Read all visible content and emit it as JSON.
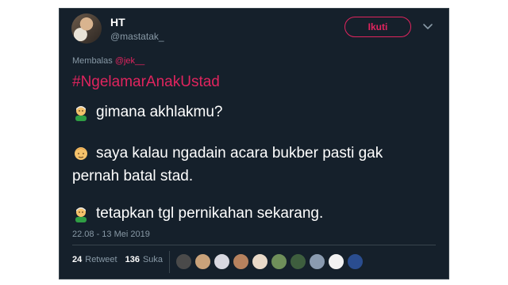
{
  "user": {
    "display_name": "HT",
    "handle": "@mastatak_"
  },
  "follow_button_label": "Ikuti",
  "reply": {
    "prefix": "Membalas",
    "mention": "@jek__"
  },
  "tweet": {
    "hashtag": "#NgelamarAnakUstad",
    "lines": [
      "gimana akhlakmu?",
      "saya kalau ngadain acara bukber pasti gak",
      "pernah batal stad.",
      "tetapkan tgl pernikahan sekarang."
    ]
  },
  "timestamp": "22.08 - 13 Mei 2019",
  "stats": {
    "retweets_count": "24",
    "retweets_label": "Retweet",
    "likes_count": "136",
    "likes_label": "Suka"
  },
  "liker_colors": [
    "#4a4a4a",
    "#c9a27a",
    "#d8d8e0",
    "#b7825e",
    "#e9d9c8",
    "#6f8f5a",
    "#3e5e3e",
    "#8a9bb0",
    "#f2f2f2",
    "#2a4d8f"
  ],
  "colors": {
    "background": "#15202b",
    "accent": "#e0245e",
    "muted_text": "#8899a6"
  }
}
